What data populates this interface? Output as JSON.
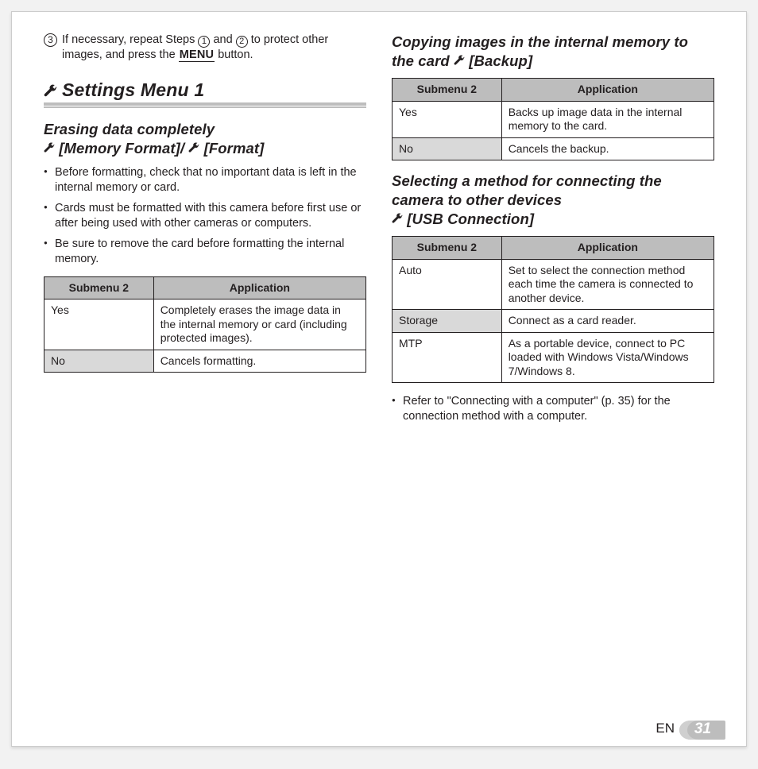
{
  "step3": {
    "prefix": "If necessary, repeat Steps ",
    "mid1": " and ",
    "mid2": " to protect other images, and press the ",
    "menuLabel": "MENU",
    "suffix": " button."
  },
  "sectionTitle": "Settings Menu 1",
  "erasing": {
    "title1": "Erasing data completely",
    "title2a": "[Memory Format]/",
    "title2b": "[Format]",
    "bullets": [
      "Before formatting, check that no important data is left in the internal memory or card.",
      "Cards must be formatted with this camera before first use or after being used with other cameras or computers.",
      "Be sure to remove the card before formatting the internal memory."
    ],
    "th1": "Submenu 2",
    "th2": "Application",
    "rows": [
      {
        "k": "Yes",
        "v": "Completely erases the image data in the internal memory or card (including protected images).",
        "grey": false
      },
      {
        "k": "No",
        "v": "Cancels formatting.",
        "grey": true
      }
    ]
  },
  "backup": {
    "title1": "Copying images in the internal memory to the card ",
    "title2": "[Backup]",
    "th1": "Submenu 2",
    "th2": "Application",
    "rows": [
      {
        "k": "Yes",
        "v": "Backs up image data in the internal memory to the card.",
        "grey": false
      },
      {
        "k": "No",
        "v": "Cancels the backup.",
        "grey": true
      }
    ]
  },
  "usb": {
    "title1": "Selecting a method for connecting the camera to other devices",
    "title2": "[USB Connection]",
    "th1": "Submenu 2",
    "th2": "Application",
    "rows": [
      {
        "k": "Auto",
        "v": "Set to select the connection method each time the camera is connected to another device.",
        "grey": false
      },
      {
        "k": "Storage",
        "v": "Connect as a card reader.",
        "grey": true
      },
      {
        "k": "MTP",
        "v": "As a portable device, connect to PC loaded with Windows Vista/Windows 7/Windows 8.",
        "grey": false
      }
    ],
    "note": "Refer to \"Connecting with a computer\" (p. 35) for the connection method with a computer."
  },
  "footer": {
    "lang": "EN",
    "page": "31"
  }
}
